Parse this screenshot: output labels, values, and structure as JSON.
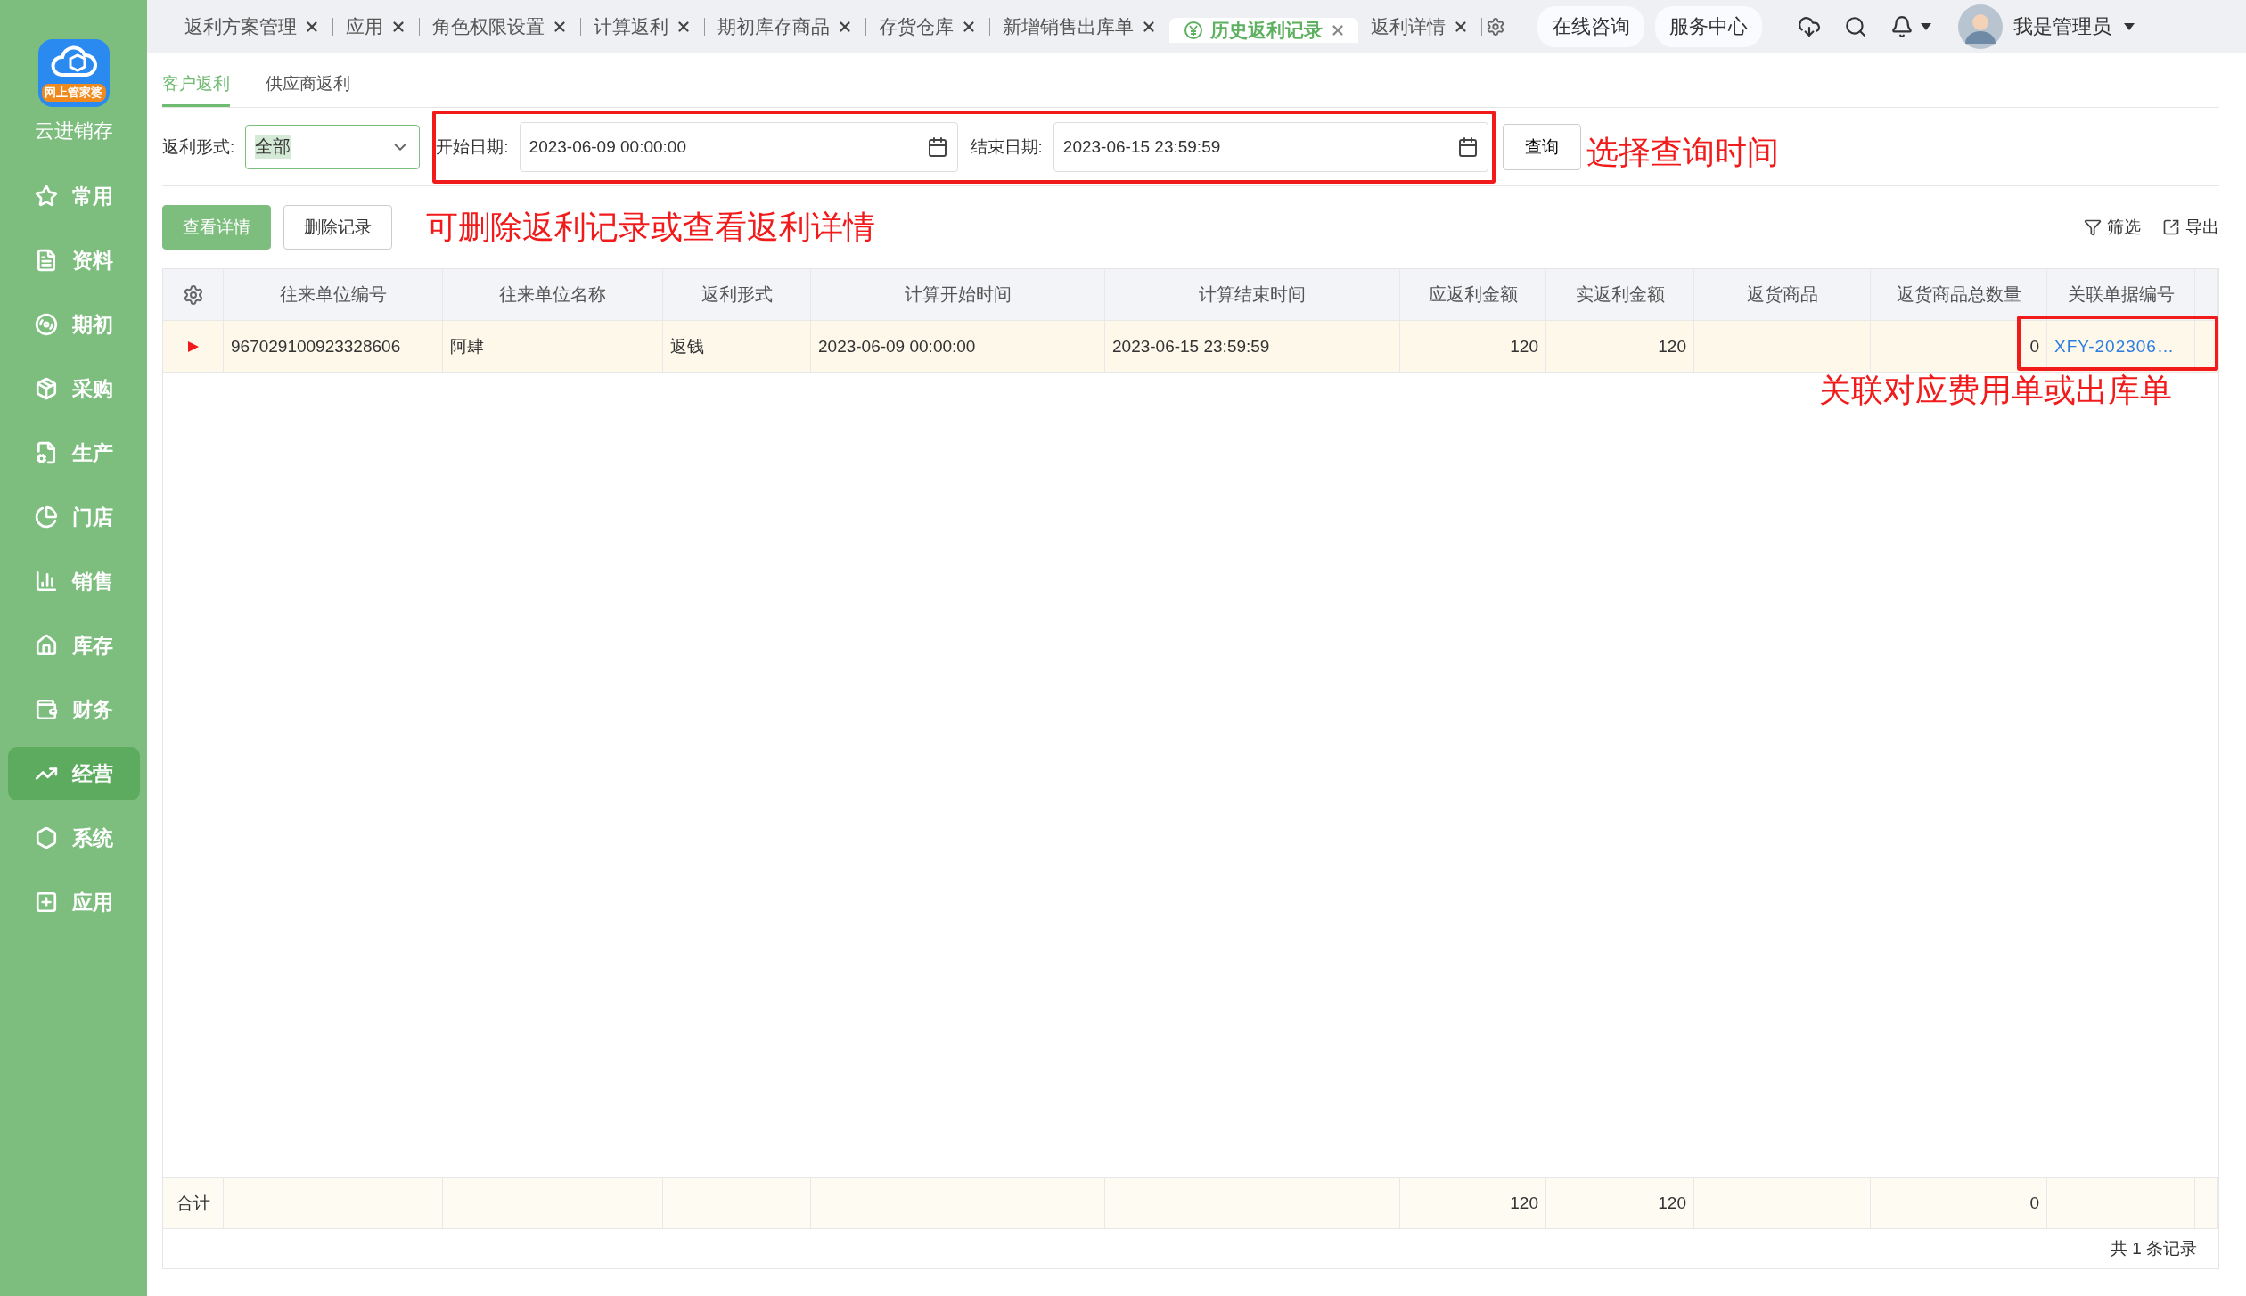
{
  "app": {
    "name": "云进销存",
    "logo_caption": "网上管家婆"
  },
  "sidebar": {
    "items": [
      {
        "label": "常用",
        "selected": false
      },
      {
        "label": "资料",
        "selected": false
      },
      {
        "label": "期初",
        "selected": false
      },
      {
        "label": "采购",
        "selected": false
      },
      {
        "label": "生产",
        "selected": false
      },
      {
        "label": "门店",
        "selected": false
      },
      {
        "label": "销售",
        "selected": false
      },
      {
        "label": "库存",
        "selected": false
      },
      {
        "label": "财务",
        "selected": false
      },
      {
        "label": "经营",
        "selected": true
      },
      {
        "label": "系统",
        "selected": false
      },
      {
        "label": "应用",
        "selected": false
      }
    ]
  },
  "tabs": [
    {
      "label": "返利方案管理",
      "selected": false
    },
    {
      "label": "应用",
      "selected": false
    },
    {
      "label": "角色权限设置",
      "selected": false
    },
    {
      "label": "计算返利",
      "selected": false
    },
    {
      "label": "期初库存商品",
      "selected": false
    },
    {
      "label": "存货仓库",
      "selected": false
    },
    {
      "label": "新增销售出库单",
      "selected": false
    },
    {
      "label": "历史返利记录",
      "selected": true
    },
    {
      "label": "返利详情",
      "selected": false
    }
  ],
  "header": {
    "buttons": [
      "在线咨询",
      "服务中心"
    ],
    "user": "我是管理员"
  },
  "subtabs": [
    {
      "label": "客户返利",
      "selected": true
    },
    {
      "label": "供应商返利",
      "selected": false
    }
  ],
  "filters": {
    "type_label": "返利形式:",
    "type_value": "全部",
    "start_label": "开始日期:",
    "start_value": "2023-06-09 00:00:00",
    "end_label": "结束日期:",
    "end_value": "2023-06-15 23:59:59",
    "query_button": "查询"
  },
  "actions": {
    "buttons": [
      {
        "label": "查看详情",
        "kind": "primary"
      },
      {
        "label": "删除记录",
        "kind": "default"
      }
    ],
    "tools": [
      {
        "label": "筛选",
        "kind": "filter"
      },
      {
        "label": "导出",
        "kind": "export"
      }
    ]
  },
  "table": {
    "columns": [
      {
        "label": "往来单位编号",
        "kind": "text"
      },
      {
        "label": "往来单位名称",
        "kind": "text"
      },
      {
        "label": "返利形式",
        "kind": "text"
      },
      {
        "label": "计算开始时间",
        "kind": "text"
      },
      {
        "label": "计算结束时间",
        "kind": "text"
      },
      {
        "label": "应返利金额",
        "kind": "number"
      },
      {
        "label": "实返利金额",
        "kind": "number"
      },
      {
        "label": "返货商品",
        "kind": "text"
      },
      {
        "label": "返货商品总数量",
        "kind": "number"
      },
      {
        "label": "关联单据编号",
        "kind": "link"
      }
    ],
    "rows": [
      {
        "selected": true,
        "cells": [
          "967029100923328606",
          "阿肆",
          "返钱",
          "2023-06-09 00:00:00",
          "2023-06-15 23:59:59",
          "120",
          "120",
          null,
          "0",
          "XFY-202306…"
        ]
      }
    ],
    "totals": {
      "label": "合计",
      "cells": [
        null,
        null,
        null,
        null,
        null,
        "120",
        "120",
        null,
        "0",
        null
      ]
    },
    "pagination": "共 1 条记录"
  },
  "annotations": {
    "query": "选择查询时间",
    "actions": "可删除返利记录或查看返利详情",
    "link": "关联对应费用单或出库单"
  }
}
